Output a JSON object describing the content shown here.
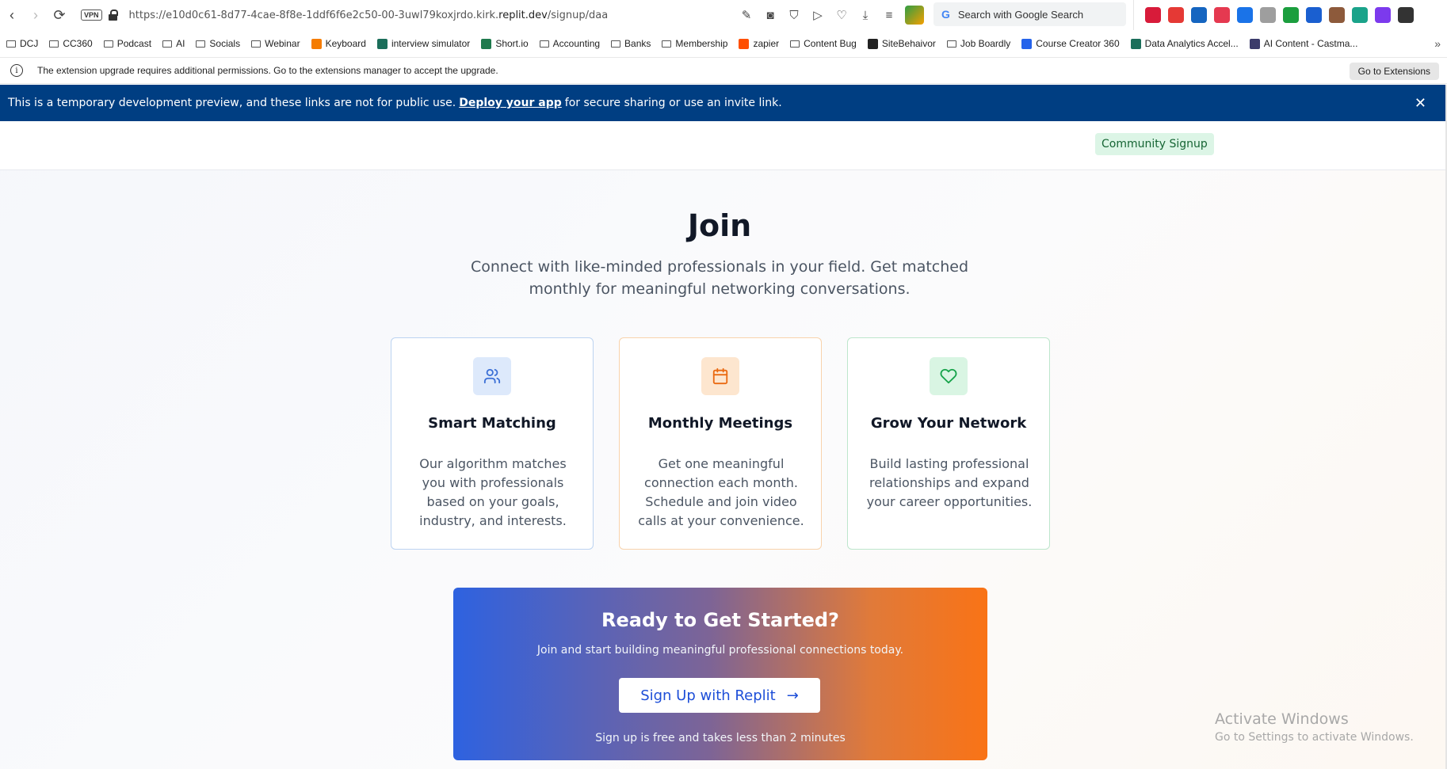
{
  "browser": {
    "url_prefix": "https://e10d0c61-8d77-4cae-8f8e-1ddf6f6e2c50-00-3uwl79koxjrdo.kirk.",
    "url_domain": "replit.dev",
    "url_path": "/signup/daa",
    "vpn_label": "VPN",
    "search_placeholder": "Search with Google Search",
    "search_logo": "G",
    "toolbar_icons": [
      "edit-icon",
      "camera-icon",
      "shield-icon",
      "play-icon",
      "heart-icon",
      "download-icon",
      "menu-icon"
    ],
    "extension_colors": [
      "#d81b3a",
      "#e53935",
      "#1565c0",
      "#e53950",
      "#1a73e8",
      "#9e9e9e",
      "#1b9e3e",
      "#1a5fd0",
      "#8d5a3b",
      "#1aa38a",
      "#7c3aed",
      "#333333"
    ]
  },
  "bookmarks": [
    {
      "label": "DCJ",
      "type": "folder"
    },
    {
      "label": "CC360",
      "type": "folder"
    },
    {
      "label": "Podcast",
      "type": "folder"
    },
    {
      "label": "AI",
      "type": "folder"
    },
    {
      "label": "Socials",
      "type": "folder"
    },
    {
      "label": "Webinar",
      "type": "folder"
    },
    {
      "label": "Keyboard",
      "type": "link",
      "color": "#f57c00"
    },
    {
      "label": "interview simulator",
      "type": "link",
      "color": "#1b6e5a"
    },
    {
      "label": "Short.io",
      "type": "link",
      "color": "#1f7a4d"
    },
    {
      "label": "Accounting",
      "type": "folder"
    },
    {
      "label": "Banks",
      "type": "folder"
    },
    {
      "label": "Membership",
      "type": "folder"
    },
    {
      "label": "zapier",
      "type": "link",
      "color": "#ff4f00"
    },
    {
      "label": "Content Bug",
      "type": "folder"
    },
    {
      "label": "SiteBehaivor",
      "type": "link",
      "color": "#222222"
    },
    {
      "label": "Job Boardly",
      "type": "folder"
    },
    {
      "label": "Course Creator 360",
      "type": "link",
      "color": "#2563eb"
    },
    {
      "label": "Data Analytics Accel...",
      "type": "link",
      "color": "#1b6e5a"
    },
    {
      "label": "AI Content - Castma...",
      "type": "link",
      "color": "#3b3b6b"
    }
  ],
  "bookmarks_more": "»",
  "extension_notice": {
    "text": "The extension upgrade requires additional permissions. Go to the extensions manager to accept the upgrade.",
    "button": "Go to Extensions",
    "info_glyph": "i"
  },
  "dev_banner": {
    "text_before": "This is a temporary development preview, and these links are not for public use.",
    "link": "Deploy your app",
    "text_after": "for secure sharing or use an invite link.",
    "close": "✕"
  },
  "header": {
    "badge": "Community Signup"
  },
  "hero": {
    "title": "Join",
    "subtitle": "Connect with like-minded professionals in your field. Get matched monthly for meaningful networking conversations."
  },
  "features": [
    {
      "icon": "users-icon",
      "title": "Smart Matching",
      "description": "Our algorithm matches you with professionals based on your goals, industry, and interests.",
      "accent": "#3b6fd6"
    },
    {
      "icon": "calendar-icon",
      "title": "Monthly Meetings",
      "description": "Get one meaningful connection each month. Schedule and join video calls at your convenience.",
      "accent": "#ea6a12"
    },
    {
      "icon": "heart-icon",
      "title": "Grow Your Network",
      "description": "Build lasting professional relationships and expand your career opportunities.",
      "accent": "#16a34a"
    }
  ],
  "cta": {
    "title": "Ready to Get Started?",
    "subtitle": "Join and start building meaningful professional connections today.",
    "button": "Sign Up with Replit",
    "button_arrow": "→",
    "note": "Sign up is free and takes less than 2 minutes"
  },
  "windows_watermark": {
    "line1": "Activate Windows",
    "line2": "Go to Settings to activate Windows."
  }
}
